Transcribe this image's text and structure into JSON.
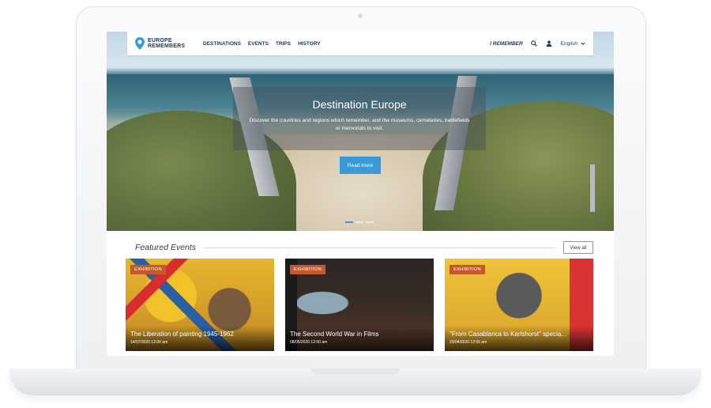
{
  "header": {
    "logo_line1": "EUROPE",
    "logo_line2": "REMEMBERS",
    "nav": [
      "DESTINATIONS",
      "EVENTS",
      "TRIPS",
      "HISTORY"
    ],
    "i_remember": "I REMEMBER",
    "language": "English"
  },
  "hero": {
    "title": "Destination Europe",
    "description": "Discover the countries and regions which remember, and the museums, cemeteries, battlefields or memorials to visit.",
    "button": "Read more",
    "slides": 3,
    "active_slide": 1
  },
  "featured": {
    "title": "Featured Events",
    "view_all": "View all",
    "events": [
      {
        "badge": "EXHIBITION",
        "title": "The Liberation of painting 1945-1962",
        "date": "14/07/2020 12:00 am"
      },
      {
        "badge": "EXHIBITION",
        "title": "The Second World War in Films",
        "date": "08/05/2020 12:00 am"
      },
      {
        "badge": "EXHIBITION",
        "title": "\"From Casablanca to Karlshorst\" specia...",
        "date": "29/04/2020 12:00 am"
      }
    ]
  },
  "colors": {
    "brand_navy": "#1d3557",
    "accent_blue": "#3a99d8",
    "badge_orange": "#c4592c"
  }
}
